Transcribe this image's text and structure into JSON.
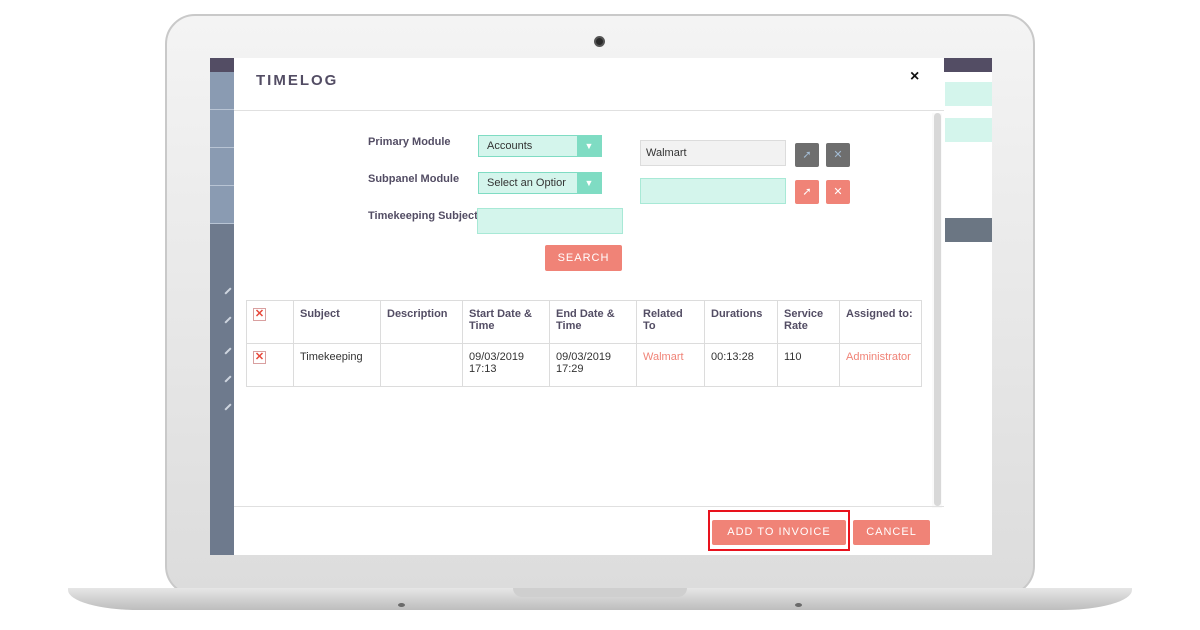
{
  "modal": {
    "title": "TIMELOG",
    "close_label": "×"
  },
  "form": {
    "primary_module_label": "Primary Module",
    "primary_module_value": "Accounts",
    "subpanel_module_label": "Subpanel Module",
    "subpanel_module_value": "Select an Optior",
    "subject_label": "Timekeeping Subject",
    "subject_value": "",
    "related_value": "Walmart",
    "subpanel_related_value": "",
    "search_label": "SEARCH"
  },
  "table": {
    "headers": [
      "Subject",
      "Description",
      "Start Date & Time",
      "End Date & Time",
      "Related To",
      "Durations",
      "Service Rate",
      "Assigned to:"
    ],
    "rows": [
      {
        "subject": "Timekeeping",
        "description": "",
        "start_date": "09/03/2019",
        "start_time": "17:13",
        "end_date": "09/03/2019",
        "end_time": "17:29",
        "related_to": "Walmart",
        "duration": "00:13:28",
        "service_rate": "110",
        "assigned_to": "Administrator"
      }
    ]
  },
  "footer": {
    "add_to_invoice_label": "ADD TO INVOICE",
    "cancel_label": "CANCEL"
  },
  "icons": {
    "select": "select-cursor-icon",
    "clear": "clear-x-icon",
    "remove": "remove-x-icon",
    "dropdown": "chevron-down-icon"
  },
  "colors": {
    "accent": "#f08377",
    "field_bg": "#d4f5ec",
    "title": "#534d64",
    "highlight": "#e8121d"
  }
}
